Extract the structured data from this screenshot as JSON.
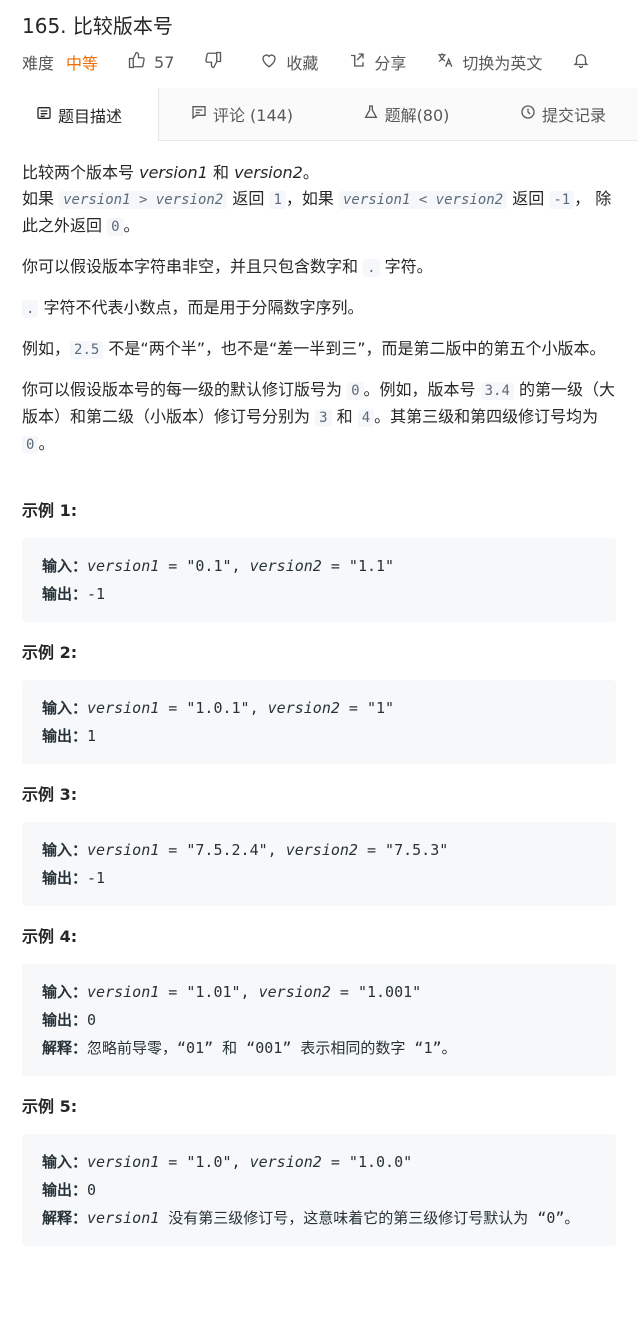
{
  "problem": {
    "title": "165. 比较版本号",
    "difficulty_label": "难度",
    "difficulty": "中等",
    "likes": "57",
    "favorite": "收藏",
    "share": "分享",
    "switch_lang": "切换为英文"
  },
  "tabs": [
    {
      "label": "题目描述"
    },
    {
      "label": "评论 (144)"
    },
    {
      "label": "题解(80)"
    },
    {
      "label": "提交记录"
    }
  ],
  "desc": {
    "p1_a": "比较两个版本号 ",
    "p1_v1": "version1",
    "p1_and": " 和 ",
    "p1_v2": "version2",
    "p1_end": "。",
    "p2_a": "如果 ",
    "p2_code1": "version1 > version2",
    "p2_b": " 返回 ",
    "p2_code2": "1",
    "p2_c": "，如果 ",
    "p2_code3": "version1 < version2",
    "p2_d": " 返回 ",
    "p2_code4": "-1",
    "p2_e": "， 除此之外返回 ",
    "p2_code5": "0",
    "p2_f": "。",
    "p3_a": "你可以假设版本字符串非空，并且只包含数字和 ",
    "p3_code": ".",
    "p3_b": " 字符。",
    "p4_code": ".",
    "p4_b": " 字符不代表小数点，而是用于分隔数字序列。",
    "p5_a": "例如，",
    "p5_code": "2.5",
    "p5_b": " 不是“两个半”，也不是“差一半到三”，而是第二版中的第五个小版本。",
    "p6_a": "你可以假设版本号的每一级的默认修订版号为 ",
    "p6_code1": "0",
    "p6_b": "。例如，版本号 ",
    "p6_code2": "3.4",
    "p6_c": " 的第一级（大版本）和第二级（小版本）修订号分别为 ",
    "p6_code3": "3",
    "p6_d": " 和 ",
    "p6_code4": "4",
    "p6_e": "。其第三级和第四级修订号均为 ",
    "p6_code5": "0",
    "p6_f": "。"
  },
  "examples": [
    {
      "title": "示例 1:",
      "in_label": "输入：",
      "v1": "\"0.1\"",
      "v2": "\"1.1\"",
      "out_label": "输出：",
      "out": "-1"
    },
    {
      "title": "示例 2:",
      "in_label": "输入：",
      "v1": "\"1.0.1\"",
      "v2": "\"1\"",
      "out_label": "输出：",
      "out": "1"
    },
    {
      "title": "示例 3:",
      "in_label": "输入：",
      "v1": "\"7.5.2.4\"",
      "v2": "\"7.5.3\"",
      "out_label": "输出：",
      "out": "-1"
    },
    {
      "title": "示例 4:",
      "in_label": "输入：",
      "v1": "\"1.01\"",
      "v2": "\"1.001\"",
      "out_label": "输出：",
      "out": "0",
      "exp_label": "解释：",
      "exp": "忽略前导零，“01” 和 “001” 表示相同的数字 “1”。"
    },
    {
      "title": "示例 5:",
      "in_label": "输入：",
      "v1": "\"1.0\"",
      "v2": "\"1.0.0\"",
      "out_label": "输出：",
      "out": "0",
      "exp_label": "解释：",
      "exp_it": "version1",
      "exp": " 没有第三级修订号，这意味着它的第三级修订号默认为 “0”。"
    }
  ],
  "vars": {
    "v1": "version1",
    "v2": "version2",
    "eq": " = ",
    "comma": ", "
  }
}
